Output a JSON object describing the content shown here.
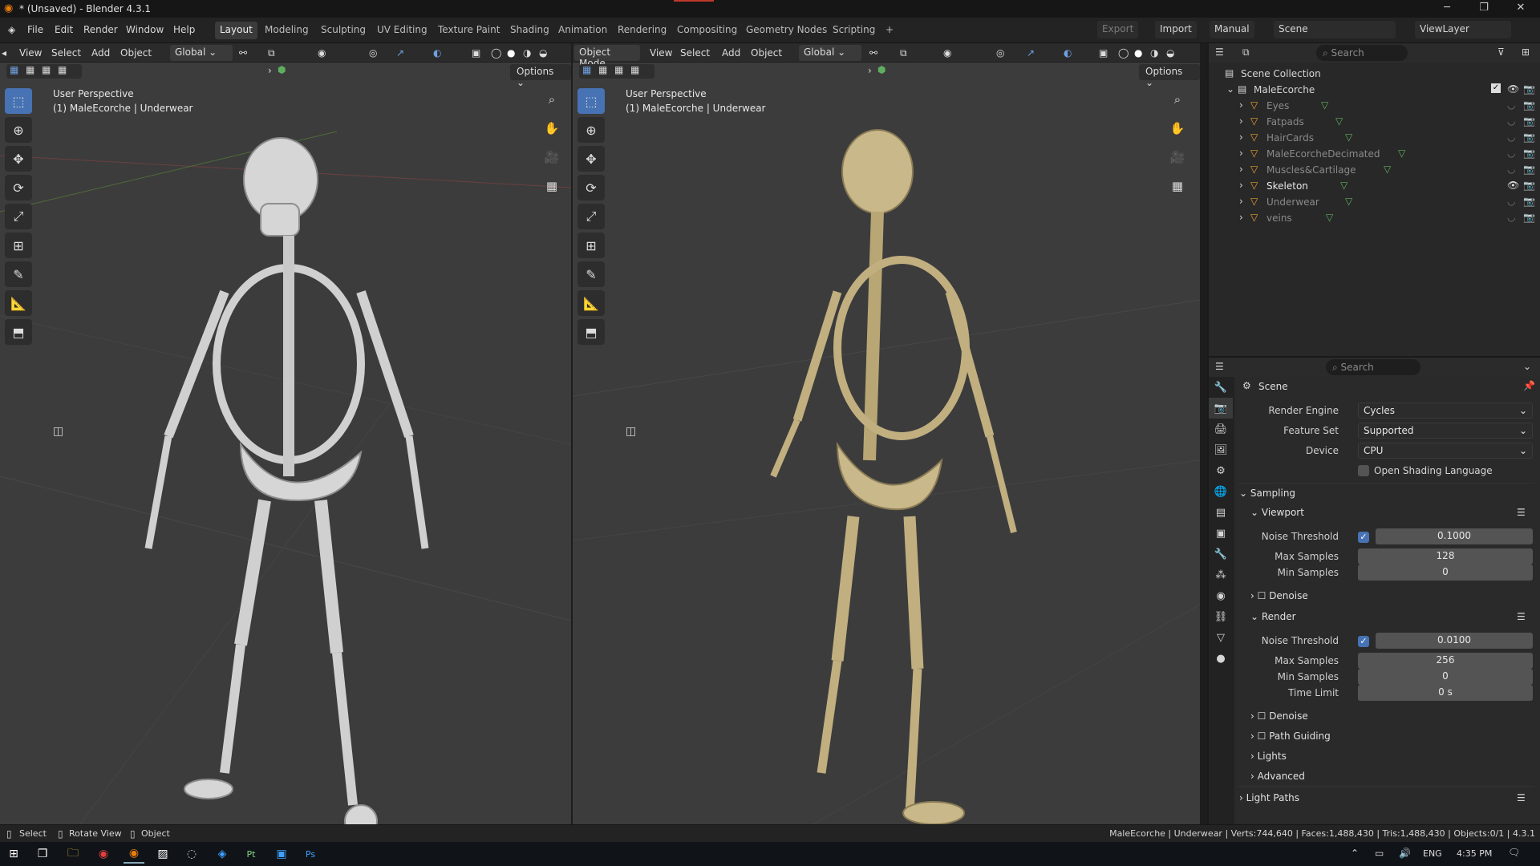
{
  "window": {
    "title": "* (Unsaved) - Blender 4.3.1",
    "minimize": "─",
    "maximize": "❐",
    "close": "✕"
  },
  "menu": [
    "File",
    "Edit",
    "Render",
    "Window",
    "Help"
  ],
  "workspaces": [
    "Layout",
    "Modeling",
    "Sculpting",
    "UV Editing",
    "Texture Paint",
    "Shading",
    "Animation",
    "Rendering",
    "Compositing",
    "Geometry Nodes",
    "Scripting",
    "+"
  ],
  "topright": {
    "export": "Export",
    "import": "Import",
    "manual": "Manual",
    "scene": "Scene",
    "viewlayer": "ViewLayer"
  },
  "vp_left": {
    "header": [
      "View",
      "Select",
      "Add",
      "Object"
    ],
    "orientation": "Global",
    "options": "Options",
    "perspective": "User Perspective",
    "object": "(1) MaleEcorche | Underwear"
  },
  "vp_right": {
    "mode": "Object Mode",
    "header": [
      "View",
      "Select",
      "Add",
      "Object"
    ],
    "orientation": "Global",
    "options": "Options",
    "perspective": "User Perspective",
    "object": "(1) MaleEcorche | Underwear"
  },
  "outliner": {
    "search": "Search",
    "collection": "Scene Collection",
    "root": "MaleEcorche",
    "items": [
      "Eyes",
      "Fatpads",
      "HairCards",
      "MaleEcorcheDecimated",
      "Muscles&Cartilage",
      "Skeleton",
      "Underwear",
      "veins"
    ]
  },
  "props": {
    "search": "Search",
    "context": "Scene",
    "render_engine_label": "Render Engine",
    "render_engine": "Cycles",
    "feature_set_label": "Feature Set",
    "feature_set": "Supported",
    "device_label": "Device",
    "device": "CPU",
    "osl": "Open Shading Language",
    "sampling": "Sampling",
    "viewport": "Viewport",
    "noise_threshold_label": "Noise Threshold",
    "vp_noise": "0.1000",
    "max_samples_label": "Max Samples",
    "vp_max": "128",
    "min_samples_label": "Min Samples",
    "vp_min": "0",
    "denoise": "Denoise",
    "render": "Render",
    "r_noise": "0.0100",
    "r_max": "256",
    "r_min": "0",
    "time_limit_label": "Time Limit",
    "r_time": "0 s",
    "denoise2": "Denoise",
    "path_guiding": "Path Guiding",
    "lights": "Lights",
    "advanced": "Advanced",
    "light_paths": "Light Paths"
  },
  "status": {
    "select": "Select",
    "rotate": "Rotate View",
    "object": "Object",
    "stats": "MaleEcorche | Underwear | Verts:744,640 | Faces:1,488,430 | Tris:1,488,430 | Objects:0/1 | 4.3.1"
  },
  "taskbar": {
    "lang": "ENG",
    "time": "4:35 PM"
  },
  "colors": {
    "accent": "#4772b3",
    "bone_white": "#d9d9d9",
    "bone_tan": "#c9b88a"
  }
}
